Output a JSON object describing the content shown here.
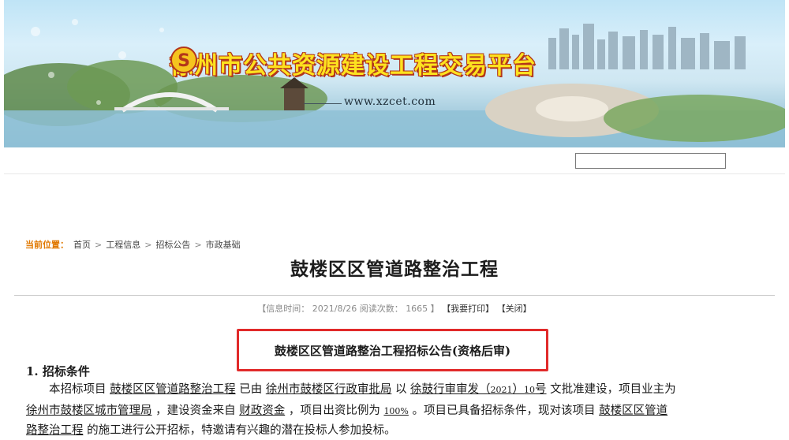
{
  "header": {
    "site_title": "徐州市公共资源建设工程交易平台",
    "site_url": "www.xzcet.com",
    "logo_icon": "s-coin-logo-icon",
    "title_color": "#fde21f",
    "title_outline_color": "#b3361a"
  },
  "search": {
    "value": "",
    "placeholder": ""
  },
  "breadcrumb": {
    "prefix": "当前位置：",
    "items": [
      "首页",
      "工程信息",
      "招标公告",
      "市政基础"
    ],
    "separator": ">"
  },
  "article": {
    "title": "鼓楼区区管道路整治工程",
    "meta_info": "【信息时间：  2021/8/26    阅读次数：  1665  】",
    "print_label": "【我要打印】",
    "close_label": "【关闭】",
    "highlight_color": "#e12a2a"
  },
  "notice": {
    "title": "鼓楼区区管道路整治工程招标公告(资格后审)",
    "section_heading": "1.  招标条件",
    "line1_a": "本招标项目",
    "line1_project": "鼓楼区区管道路整治工程",
    "line1_b": "已由",
    "line1_approver": "徐州市鼓楼区行政审批局",
    "line1_c": "以",
    "line1_doc_a": "徐鼓行审审发（",
    "line1_doc_year": "2021",
    "line1_doc_b": "）",
    "line1_doc_num": "10",
    "line1_doc_c": "号",
    "line1_d": "文批准建设，项目业主为",
    "line2_owner": "徐州市鼓楼区城市管理局",
    "line2_a": "，建设资金来自",
    "line2_fund": "财政资金",
    "line2_b": "，项目出资比例为",
    "line2_ratio": "100%",
    "line2_c": "。项目已具备招标条件，现对该项目",
    "line2_project": "鼓楼区区管道",
    "line3_project": "路整治工程",
    "line3_a": "的施工进行公开招标，特邀请有兴趣的潜在投标人参加投标。"
  }
}
